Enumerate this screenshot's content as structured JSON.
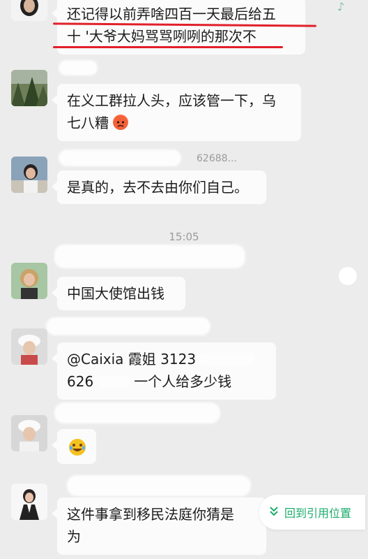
{
  "colors": {
    "background": "#ececec",
    "bubble": "#fbfbfb",
    "annotation_red": "#e1202a",
    "accent_green": "#1aad6b",
    "timestamp_text": "#9a9a9a"
  },
  "messages": [
    {
      "avatar": "avatar-woman-dark-hair",
      "lines": [
        "还记得以前弄啥四百一天最后给五",
        "十 '大爷大妈骂骂咧咧的那次不"
      ],
      "highlighted": true
    },
    {
      "avatar": "avatar-forest-photo",
      "sender_visible": "",
      "lines": [
        "在义工群拉人头，应该管一下，乌",
        "七八糟"
      ],
      "emoji": "angry-face-emoji"
    },
    {
      "avatar": "avatar-woman-outdoor",
      "sender_visible": "62688...",
      "lines": [
        "是真的，去不去由你们自己。"
      ]
    },
    {
      "avatar": "avatar-woman-blonde",
      "lines": [
        "中国大使馆出钱"
      ]
    },
    {
      "avatar": "avatar-person-white-cap",
      "lines": [
        "@Caixia 霞姐 3123",
        "626",
        "一个人给多少钱"
      ]
    },
    {
      "avatar": "avatar-person-white-cap-2",
      "emoji_only": "crying-laughing-emoji"
    },
    {
      "avatar": "avatar-woman-suit",
      "lines": [
        "这件事拿到移民法庭你猜是",
        "为"
      ]
    }
  ],
  "timestamp": "15:05",
  "jump_button": {
    "icon": "double-chevron-down-icon",
    "label": "回到引用位置"
  }
}
